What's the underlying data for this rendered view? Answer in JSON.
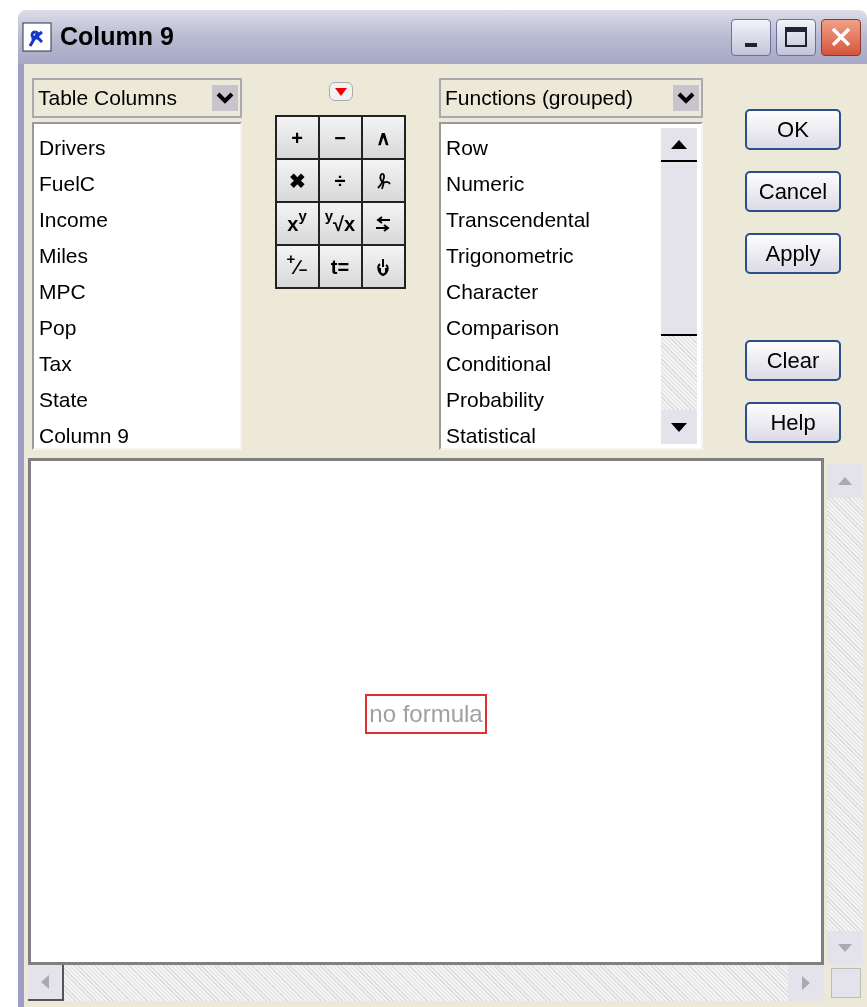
{
  "window": {
    "title": "Column 9"
  },
  "columns_dropdown": {
    "value": "Table Columns"
  },
  "columns_list": [
    "Drivers",
    "FuelC",
    "Income",
    "Miles",
    "MPC",
    "Pop",
    "Tax",
    "State",
    "Column 9"
  ],
  "keypad": [
    {
      "kind": "text",
      "label": "+"
    },
    {
      "kind": "text",
      "label": "−"
    },
    {
      "kind": "text",
      "label": "∧"
    },
    {
      "kind": "text",
      "label": "✖"
    },
    {
      "kind": "text",
      "label": "÷"
    },
    {
      "kind": "icon"
    },
    {
      "kind": "text",
      "label": "x$^{y}$"
    },
    {
      "kind": "text",
      "label": "$^{y}$√x"
    },
    {
      "kind": "icon"
    },
    {
      "kind": "text",
      "label": "$^{+}$∕$_{−}$"
    },
    {
      "kind": "text",
      "label": "t="
    },
    {
      "kind": "icon"
    }
  ],
  "functions_dropdown": {
    "value": "Functions (grouped)"
  },
  "functions_list": [
    "Row",
    "Numeric",
    "Transcendental",
    "Trigonometric",
    "Character",
    "Comparison",
    "Conditional",
    "Probability",
    "Statistical"
  ],
  "buttons": [
    "OK",
    "Cancel",
    "Apply",
    "Clear",
    "Help"
  ],
  "formula": {
    "placeholder": "no formula"
  }
}
